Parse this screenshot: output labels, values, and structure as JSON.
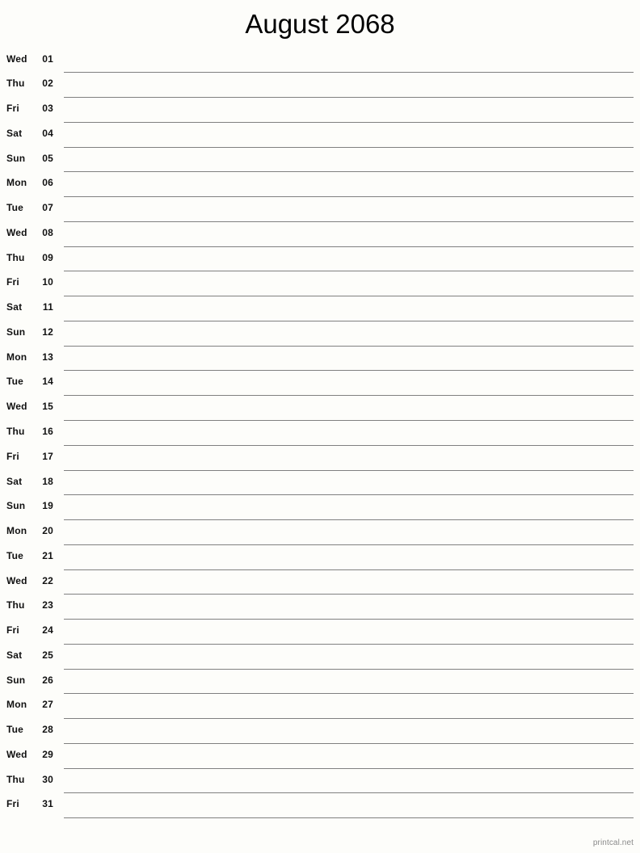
{
  "document": {
    "type": "printable-monthly-calendar",
    "title": "August 2068",
    "month_name": "August",
    "year": "2068",
    "page_background": "#fdfdfa",
    "rule_line_color": "#808080",
    "text_color": "#111111"
  },
  "footer": {
    "watermark": "printcal.net",
    "watermark_color": "#8a8a8a"
  },
  "days": [
    {
      "dow": "Wed",
      "date": "01"
    },
    {
      "dow": "Thu",
      "date": "02"
    },
    {
      "dow": "Fri",
      "date": "03"
    },
    {
      "dow": "Sat",
      "date": "04"
    },
    {
      "dow": "Sun",
      "date": "05"
    },
    {
      "dow": "Mon",
      "date": "06"
    },
    {
      "dow": "Tue",
      "date": "07"
    },
    {
      "dow": "Wed",
      "date": "08"
    },
    {
      "dow": "Thu",
      "date": "09"
    },
    {
      "dow": "Fri",
      "date": "10"
    },
    {
      "dow": "Sat",
      "date": "11"
    },
    {
      "dow": "Sun",
      "date": "12"
    },
    {
      "dow": "Mon",
      "date": "13"
    },
    {
      "dow": "Tue",
      "date": "14"
    },
    {
      "dow": "Wed",
      "date": "15"
    },
    {
      "dow": "Thu",
      "date": "16"
    },
    {
      "dow": "Fri",
      "date": "17"
    },
    {
      "dow": "Sat",
      "date": "18"
    },
    {
      "dow": "Sun",
      "date": "19"
    },
    {
      "dow": "Mon",
      "date": "20"
    },
    {
      "dow": "Tue",
      "date": "21"
    },
    {
      "dow": "Wed",
      "date": "22"
    },
    {
      "dow": "Thu",
      "date": "23"
    },
    {
      "dow": "Fri",
      "date": "24"
    },
    {
      "dow": "Sat",
      "date": "25"
    },
    {
      "dow": "Sun",
      "date": "26"
    },
    {
      "dow": "Mon",
      "date": "27"
    },
    {
      "dow": "Tue",
      "date": "28"
    },
    {
      "dow": "Wed",
      "date": "29"
    },
    {
      "dow": "Thu",
      "date": "30"
    },
    {
      "dow": "Fri",
      "date": "31"
    }
  ]
}
